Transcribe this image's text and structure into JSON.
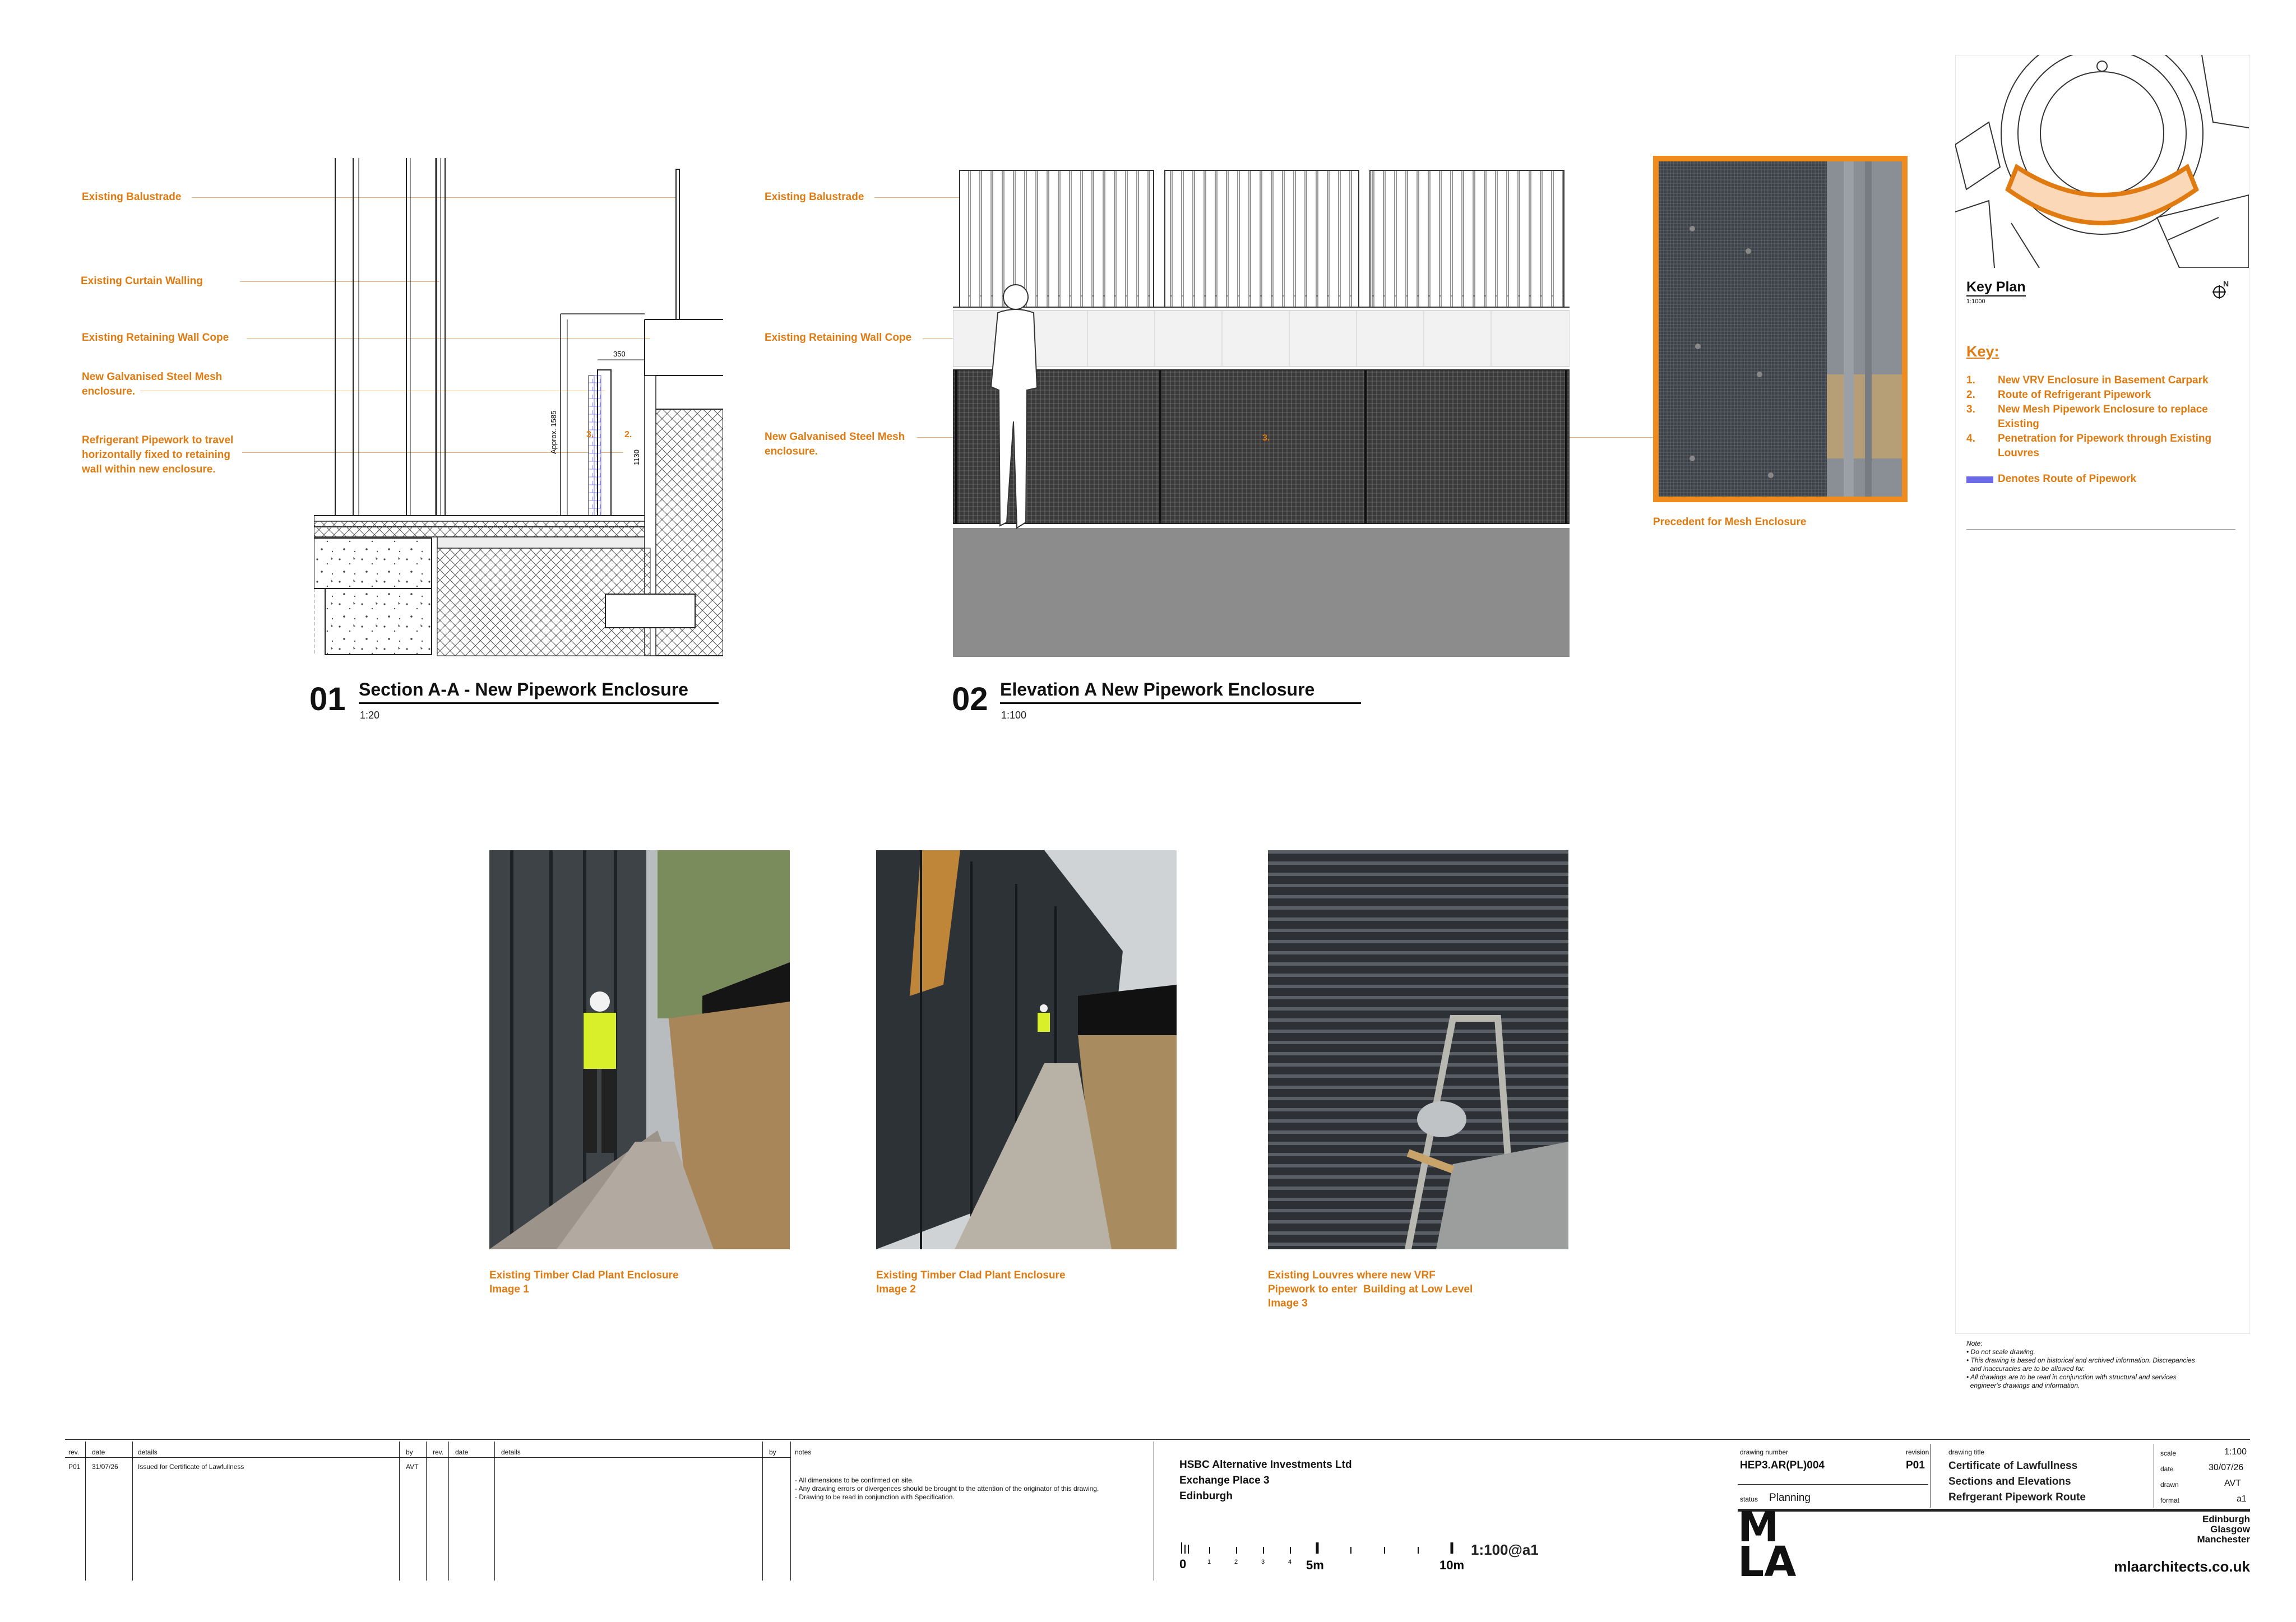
{
  "section_drawing": {
    "labels": [
      "Existing Balustrade",
      "Existing Curtain Walling",
      "Existing Retaining Wall Cope",
      "New Galvanised Steel Mesh\nenclosure.",
      "Refrigerant Pipework to travel\nhorizontally fixed to retaining\nwall within new enclosure."
    ],
    "dims": {
      "width": "350",
      "approx": "Approx. 1585",
      "height": "1130"
    },
    "markers": [
      "3.",
      "2."
    ],
    "number": "01",
    "title": "Section A-A - New Pipework Enclosure",
    "scale": "1:20"
  },
  "elevation_drawing": {
    "labels": [
      "Existing Balustrade",
      "Existing Retaining Wall Cope",
      "New Galvanised Steel Mesh\nenclosure."
    ],
    "marker": "3.",
    "number": "02",
    "title": "Elevation A New Pipework Enclosure",
    "scale": "1:100"
  },
  "precedent": {
    "caption": "Precedent for Mesh Enclosure"
  },
  "key_plan": {
    "title": "Key Plan",
    "scale": "1:1000",
    "north": "N",
    "key_heading": "Key:",
    "items": [
      {
        "num": "1.",
        "text": "New VRV Enclosure in Basement Carpark"
      },
      {
        "num": "2.",
        "text": "Route of Refrigerant Pipework"
      },
      {
        "num": "3.",
        "text": "New Mesh Pipework Enclosure to replace\nExisting"
      },
      {
        "num": "4.",
        "text": "Penetration for Pipework through Existing\nLouvres"
      }
    ],
    "route_legend": "Denotes Route of Pipework",
    "route_color": "#6B6BE8",
    "accent_color": "#E07B12",
    "note_heading": "Note:",
    "notes": [
      "• Do not scale drawing.",
      "• This drawing is based on historical and archived information. Discrepancies\n  and inaccuracies are to be allowed for.",
      "• All drawings are to be read in conjunction with structural and services\n  engineer's drawings and information."
    ]
  },
  "photos": [
    {
      "caption": "Existing Timber Clad Plant Enclosure\nImage 1"
    },
    {
      "caption": "Existing Timber Clad Plant Enclosure\nImage 2"
    },
    {
      "caption": "Existing Louvres where new VRF\nPipework to enter  Building at Low Level\nImage 3"
    }
  ],
  "title_block": {
    "rev_headers": [
      "rev.",
      "date",
      "details",
      "by"
    ],
    "rev_headers_2": [
      "rev.",
      "date",
      "details",
      "by"
    ],
    "revision_row": {
      "rev": "P01",
      "date": "31/07/26",
      "details": "Issued for Certificate of Lawfullness",
      "by": "AVT"
    },
    "notes_header": "notes",
    "notes": [
      "- All dimensions to be confirmed on site.",
      "- Any drawing errors or divergences should be brought to the attention of the originator of this drawing.",
      "- Drawing to be read in conjunction with Specification."
    ],
    "client": [
      "HSBC Alternative Investments Ltd",
      "Exchange Place 3",
      "Edinburgh"
    ],
    "scale_bar": {
      "ticks": [
        "0",
        "1",
        "2",
        "3",
        "4",
        "5m",
        "10m"
      ],
      "label": "1:100@a1"
    },
    "drawing_number_label": "drawing number",
    "drawing_number": "HEP3.AR(PL)004",
    "revision_label": "revision",
    "revision": "P01",
    "status_label": "status",
    "status": "Planning",
    "drawing_title_label": "drawing title",
    "drawing_title": [
      "Certificate of Lawfullness",
      "Sections and Elevations",
      "Refrgerant Pipework Route"
    ],
    "scale_label": "scale",
    "scale": "1:100",
    "date_label": "date",
    "date": "30/07/26",
    "drawn_label": "drawn",
    "drawn": "AVT",
    "format_label": "format",
    "format": "a1",
    "logo_top": "M",
    "logo_bottom": "LA",
    "offices": [
      "Edinburgh",
      "Glasgow",
      "Manchester"
    ],
    "website": "mlaarchitects.co.uk"
  }
}
